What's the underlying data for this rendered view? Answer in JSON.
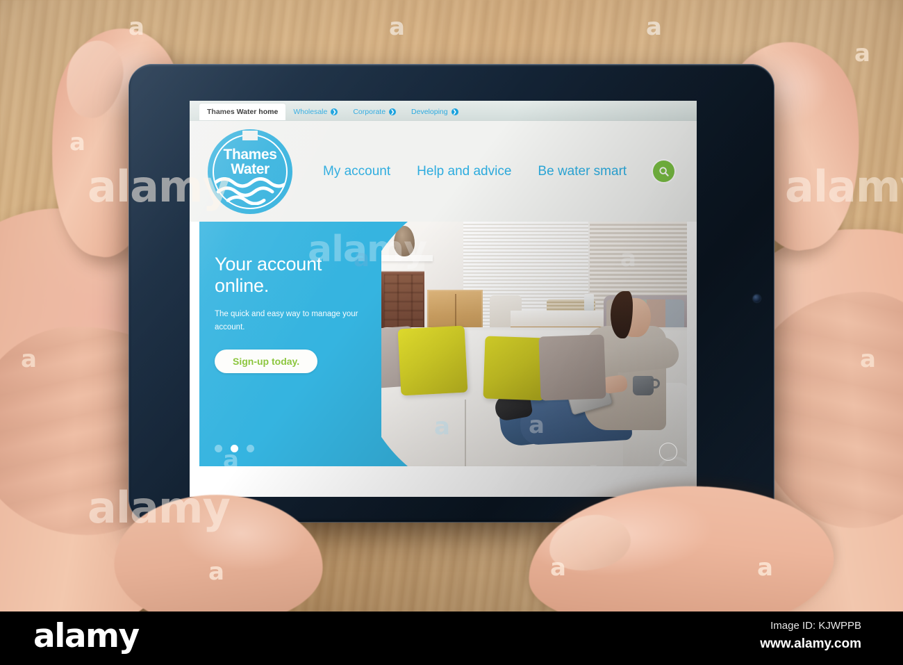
{
  "scene": {
    "description": "Hands holding a tablet displaying the Thames Water website, over a wooden desk"
  },
  "browser": {
    "tabs": [
      {
        "label": "Thames Water home",
        "active": true,
        "has_arrow": false
      },
      {
        "label": "Wholesale",
        "active": false,
        "has_arrow": true
      },
      {
        "label": "Corporate",
        "active": false,
        "has_arrow": true
      },
      {
        "label": "Developing",
        "active": false,
        "has_arrow": true
      }
    ],
    "tab_arrow_glyph": "❯"
  },
  "site": {
    "logo": {
      "line1": "Thames",
      "line2": "Water",
      "name": "thames-water-logo"
    },
    "nav": [
      {
        "label": "My account"
      },
      {
        "label": "Help and advice"
      },
      {
        "label": "Be water smart"
      }
    ],
    "search": {
      "icon": "search-icon",
      "label": "Search"
    }
  },
  "hero": {
    "title_line1": "Your account",
    "title_line2": "online.",
    "subtitle": "The quick and easy way to manage your account.",
    "cta_label": "Sign-up today.",
    "carousel": {
      "total": 3,
      "active_index": 1
    }
  },
  "watermark": {
    "brand": "alamy",
    "letter": "a",
    "image_id_label": "Image ID: KJWPPB",
    "url": "www.alamy.com"
  },
  "colors": {
    "brand_blue": "#35b4e0",
    "nav_blue": "#2cacdf",
    "tab_blue": "#2aa9e0",
    "cta_green": "#8cc63e",
    "search_green": "#7ac043",
    "header_bg": "#f1f2f0",
    "tabbar_bg": "#dde6e5",
    "tablet_body": "#16283c",
    "footer_bg": "#000000",
    "desk_wood": "#ddb887"
  }
}
